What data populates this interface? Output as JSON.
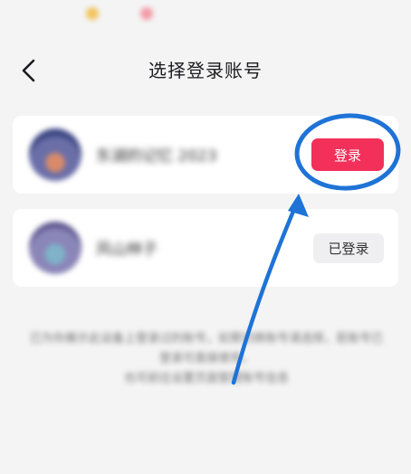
{
  "header": {
    "title": "选择登录账号",
    "back_icon": "chevron-left-icon"
  },
  "accounts": [
    {
      "name": "东湖的记忆 2023",
      "action_label": "登录",
      "state": "not-logged-in"
    },
    {
      "name": "风山林子",
      "action_label": "已登录",
      "state": "logged-in"
    }
  ],
  "notice": {
    "line1": "已为你展示此设备上登录过的账号，如需切换账号请选择，若账号已登录可直接使用，",
    "line2": "也可前往设置页面管理账号信息"
  },
  "colors": {
    "background": "#f4f4f5",
    "card": "#ffffff",
    "login_button": "#f2305a",
    "logged_button": "#efeff1",
    "annotation": "#1f73d6",
    "status_dot_1": "#f2c35c",
    "status_dot_2": "#f39aa6"
  },
  "annotation": {
    "highlight_icon": "blue-circle-highlight",
    "pointer_icon": "blue-arrow-pointer"
  }
}
